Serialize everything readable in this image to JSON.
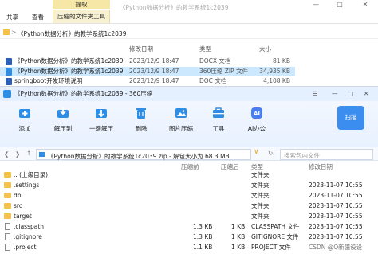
{
  "explorer": {
    "tool_context": "提取",
    "tabs": [
      "共享",
      "查看",
      "压缩的文件夹工具"
    ],
    "window_title": "《Python数据分析》的教学系统1c2039",
    "address": "《Python数据分析》的教学系统1c2039",
    "columns": {
      "modified": "修改日期",
      "type": "类型",
      "size": "大小"
    },
    "files": [
      {
        "name": "《Python数据分析》的教学系统1c2039",
        "modified": "2023/12/9 18:47",
        "type": "DOCX 文档",
        "size": "81 KB"
      },
      {
        "name": "《Python数据分析》的教学系统1c2039",
        "modified": "2023/12/9 18:47",
        "type": "360压缩 ZIP 文件",
        "size": "34,935 KB"
      },
      {
        "name": "springboot开发环境说明",
        "modified": "2023/12/9 18:47",
        "type": "DOC 文档",
        "size": "4,108 KB"
      }
    ]
  },
  "zip": {
    "title": "《Python数据分析》的教学系统1c2039 - 360压缩",
    "toolbar": [
      {
        "label": "添加",
        "icon": "add-icon"
      },
      {
        "label": "解压到",
        "icon": "extract-to-icon"
      },
      {
        "label": "一键解压",
        "icon": "one-click-extract-icon"
      },
      {
        "label": "删除",
        "icon": "delete-icon"
      },
      {
        "label": "图片压缩",
        "icon": "image-compress-icon"
      },
      {
        "label": "工具",
        "icon": "tools-icon"
      },
      {
        "label": "AI办公",
        "icon": "ai-icon"
      }
    ],
    "scan_label": "扫描",
    "path": "《Python数据分析》的教学系统1c2039.zip - 解包大小为 68.3 MB",
    "search_placeholder": "搜索包内文件",
    "columns": {
      "compressed": "压缩前",
      "after": "压缩后",
      "type": "类型",
      "modified": "修改日期"
    },
    "rows": [
      {
        "name": ".. (上级目录)",
        "before": "",
        "after": "",
        "type": "文件夹",
        "modified": "",
        "kind": "folder"
      },
      {
        "name": ".settings",
        "before": "",
        "after": "",
        "type": "文件夹",
        "modified": "2023-11-07 10:55",
        "kind": "folder"
      },
      {
        "name": "db",
        "before": "",
        "after": "",
        "type": "文件夹",
        "modified": "2023-11-07 10:55",
        "kind": "folder"
      },
      {
        "name": "src",
        "before": "",
        "after": "",
        "type": "文件夹",
        "modified": "2023-11-07 10:55",
        "kind": "folder"
      },
      {
        "name": "target",
        "before": "",
        "after": "",
        "type": "文件夹",
        "modified": "2023-11-07 10:55",
        "kind": "folder"
      },
      {
        "name": ".classpath",
        "before": "1.3 KB",
        "after": "1 KB",
        "type": "CLASSPATH 文件",
        "modified": "2023-11-07 10:55",
        "kind": "file"
      },
      {
        "name": ".gitignore",
        "before": "1.3 KB",
        "after": "1 KB",
        "type": "GITIGNORE 文件",
        "modified": "2023-11-07 10:55",
        "kind": "file"
      },
      {
        "name": ".project",
        "before": "1.1 KB",
        "after": "1 KB",
        "type": "PROJECT 文件",
        "modified": "2023-11-07 10:55",
        "kind": "file"
      }
    ],
    "watermark": "CSDN @Q新疆设设"
  }
}
